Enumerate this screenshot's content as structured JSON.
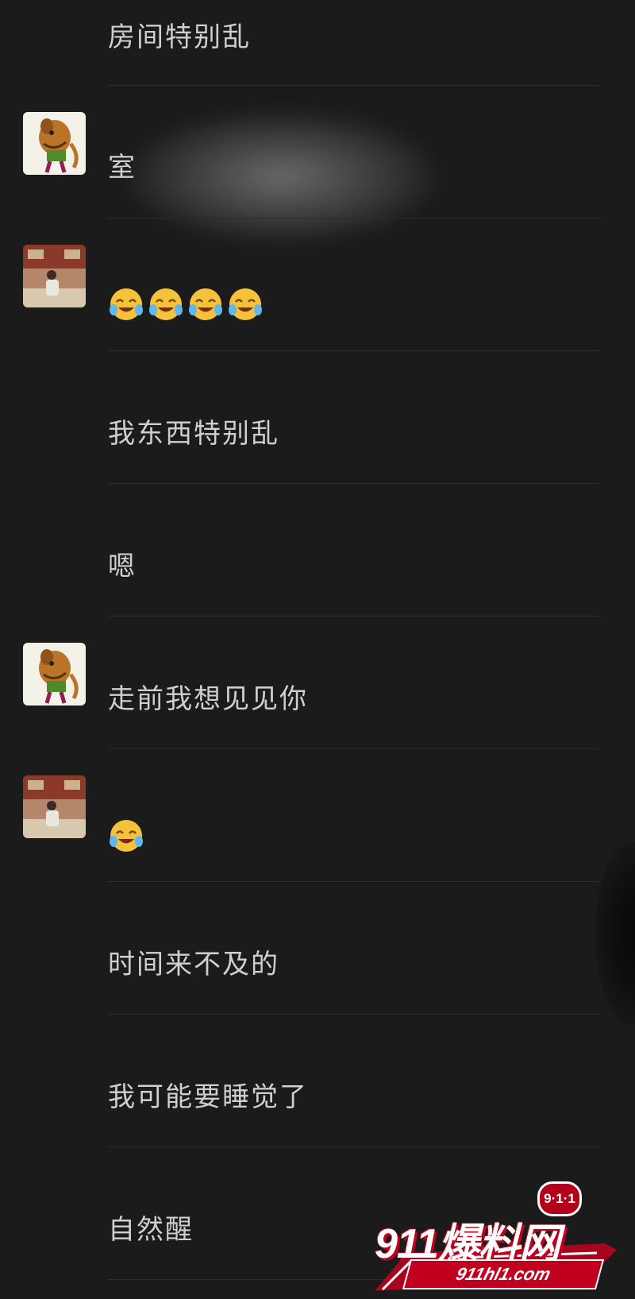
{
  "messages": [
    {
      "text": "房间特别乱",
      "avatar": "none"
    },
    {
      "text": "室",
      "avatar": "scooby-avatar"
    },
    {
      "text": "",
      "avatar": "person-avatar",
      "emoji_count": 4,
      "emoji": "laughing-crying-emoji"
    },
    {
      "text": "我东西特别乱",
      "avatar": "none"
    },
    {
      "text": "嗯",
      "avatar": "none"
    },
    {
      "text": "走前我想见见你",
      "avatar": "scooby-avatar"
    },
    {
      "text": "",
      "avatar": "person-avatar",
      "emoji_count": 1,
      "emoji": "laughing-crying-emoji"
    },
    {
      "text": "时间来不及的",
      "avatar": "none"
    },
    {
      "text": "我可能要睡觉了",
      "avatar": "none"
    },
    {
      "text": "自然醒",
      "avatar": "none"
    }
  ],
  "watermark": {
    "badge": "9·1·1",
    "brand": "911爆料网",
    "url": "911hl1.com"
  },
  "colors": {
    "background": "#1b1b1b",
    "text": "#cfcfcf",
    "divider": "#2c2c2c",
    "watermark_red": "#c0001e"
  }
}
